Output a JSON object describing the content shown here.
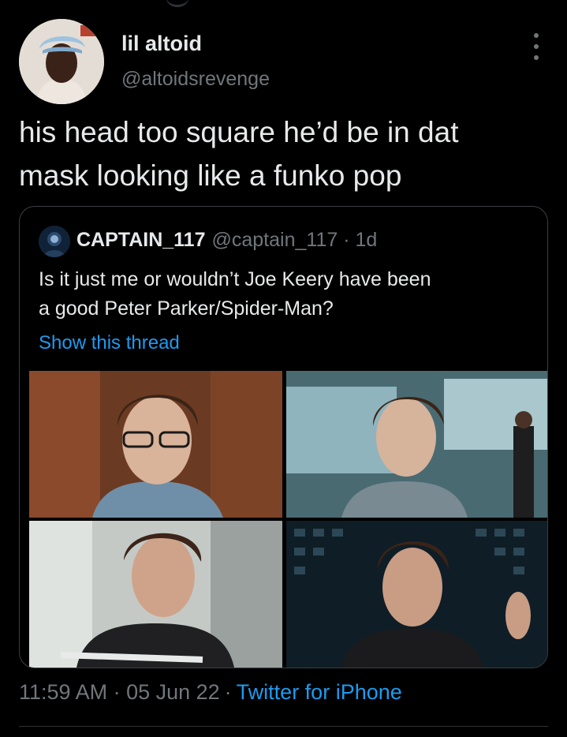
{
  "tweet": {
    "display_name": "lil altoid",
    "handle": "@altoidsrevenge",
    "text": "his head too square he’d be in dat\nmask looking like a funko pop",
    "more_icon": "more-vertical-icon",
    "timestamp": "11:59 AM · 05 Jun 22",
    "separator": "·",
    "source": "Twitter for iPhone"
  },
  "quote": {
    "display_name": "CAPTAIN_117",
    "handle_meta": "@captain_117 · 1d",
    "text": "Is it just me or wouldn’t Joe Keery have been\na good Peter Parker/Spider-Man?",
    "show_thread": "Show this thread",
    "photos": 4
  },
  "colors": {
    "background": "#000000",
    "text": "#e7e9ea",
    "secondary_text": "#71767b",
    "link": "#1d9bf0",
    "border": "#3b3f43"
  }
}
